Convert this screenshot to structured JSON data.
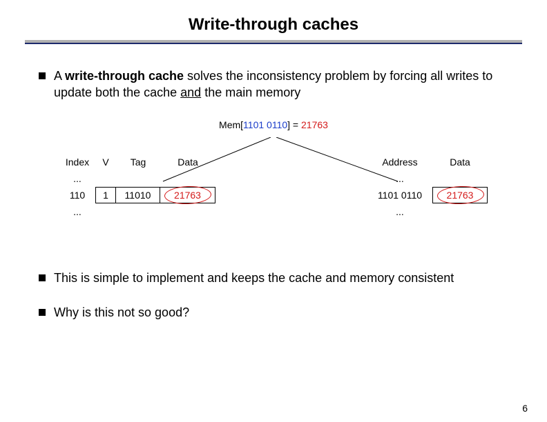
{
  "title": "Write-through caches",
  "bullets": [
    {
      "prefix": "A ",
      "bold": "write-through cache",
      "mid": " solves the inconsistency problem by forcing all writes to update both the cache ",
      "underline": "and",
      "suffix": " the main memory"
    },
    {
      "text": "This is simple to implement and keeps the cache and memory consistent"
    },
    {
      "text": "Why is this not so good?"
    }
  ],
  "mem": {
    "label": "Mem[",
    "addr": "1101 0110",
    "eq": "] = ",
    "val": "21763"
  },
  "cache": {
    "headers": {
      "index": "Index",
      "v": "V",
      "tag": "Tag",
      "data": "Data"
    },
    "ellipsis": "...",
    "row": {
      "index": "110",
      "v": "1",
      "tag": "11010",
      "data": "21763"
    }
  },
  "memory": {
    "headers": {
      "addr": "Address",
      "data": "Data"
    },
    "ellipsis": "...",
    "row": {
      "addr": "1101 0110",
      "data": "21763"
    }
  },
  "pagenum": "6"
}
